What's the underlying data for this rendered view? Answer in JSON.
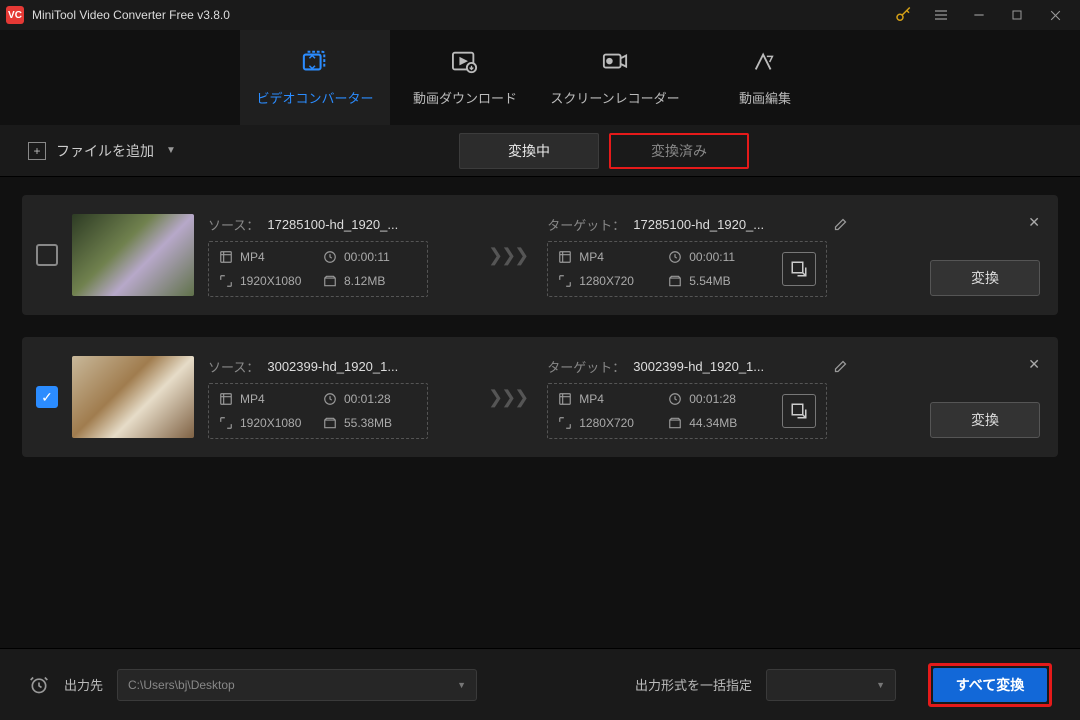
{
  "title": "MiniTool Video Converter Free v3.8.0",
  "tabs": {
    "converter": "ビデオコンバーター",
    "download": "動画ダウンロード",
    "recorder": "スクリーンレコーダー",
    "editor": "動画編集"
  },
  "toolbar": {
    "add_file": "ファイルを追加",
    "converting": "変換中",
    "converted": "変換済み"
  },
  "labels": {
    "source": "ソース：",
    "target": "ターゲット：",
    "convert_button": "変換"
  },
  "items": [
    {
      "checked": false,
      "source_name": "17285100-hd_1920_...",
      "target_name": "17285100-hd_1920_...",
      "source": {
        "format": "MP4",
        "duration": "00:00:11",
        "resolution": "1920X1080",
        "size": "8.12MB"
      },
      "target": {
        "format": "MP4",
        "duration": "00:00:11",
        "resolution": "1280X720",
        "size": "5.54MB"
      }
    },
    {
      "checked": true,
      "source_name": "3002399-hd_1920_1...",
      "target_name": "3002399-hd_1920_1...",
      "source": {
        "format": "MP4",
        "duration": "00:01:28",
        "resolution": "1920X1080",
        "size": "55.38MB"
      },
      "target": {
        "format": "MP4",
        "duration": "00:01:28",
        "resolution": "1280X720",
        "size": "44.34MB"
      }
    }
  ],
  "footer": {
    "output_label": "出力先",
    "output_path": "C:\\Users\\bj\\Desktop",
    "format_label": "出力形式を一括指定",
    "convert_all": "すべて変換"
  }
}
